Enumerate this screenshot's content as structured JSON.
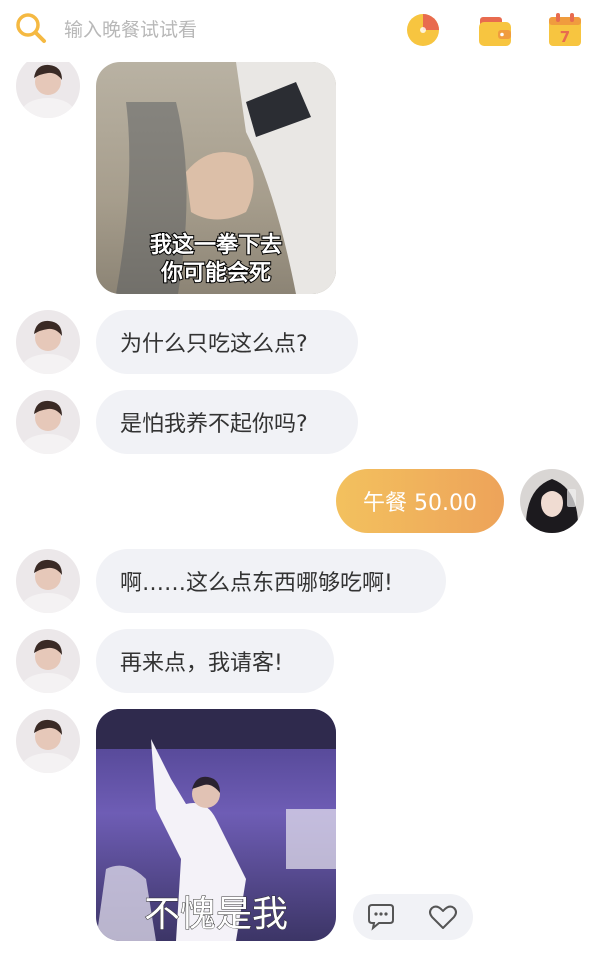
{
  "search": {
    "placeholder": "输入晚餐试试看"
  },
  "header_icons": [
    "search-icon",
    "pie-chart-icon",
    "wallet-icon",
    "calendar-icon"
  ],
  "calendar_day": "7",
  "messages": [
    {
      "type": "image",
      "sender": "other",
      "caption_lines": [
        "我这一拳下去",
        "你可能会死"
      ]
    },
    {
      "type": "text",
      "sender": "other",
      "text": "为什么只吃这么点?"
    },
    {
      "type": "text",
      "sender": "other",
      "text": "是怕我养不起你吗?"
    },
    {
      "type": "payment",
      "sender": "self",
      "text": "午餐 50.00"
    },
    {
      "type": "text",
      "sender": "other",
      "text": "啊……这么点东西哪够吃啊!"
    },
    {
      "type": "text",
      "sender": "other",
      "text": "再来点，我请客!"
    },
    {
      "type": "image",
      "sender": "other",
      "caption_lines": [
        "不愧是我"
      ]
    }
  ],
  "actions": [
    "comment-icon",
    "heart-icon"
  ],
  "colors": {
    "accent": "#f5b942",
    "payment_gradient_start": "#f3c15e",
    "payment_gradient_end": "#eda35a",
    "bubble_bg": "#f1f2f6"
  }
}
